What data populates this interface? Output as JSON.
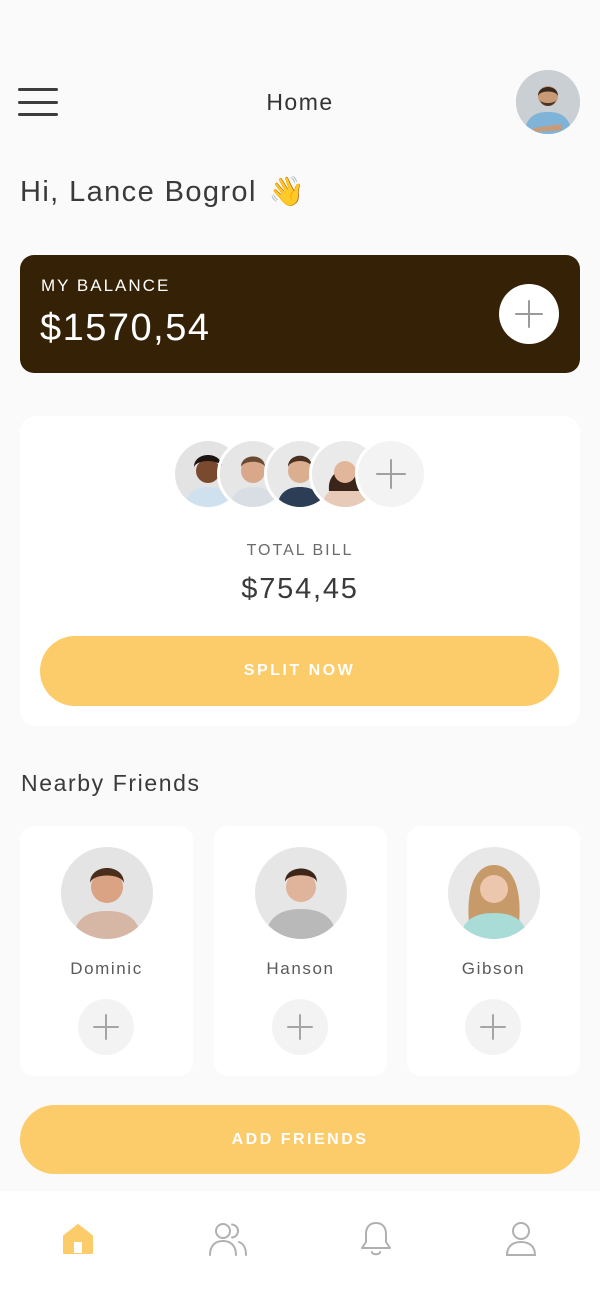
{
  "header": {
    "title": "Home",
    "menu_icon": "hamburger-menu-icon",
    "avatar_icon": "user-avatar"
  },
  "greeting": {
    "text": "Hi, Lance Bogrol",
    "emoji": "👋"
  },
  "balance": {
    "label": "MY BALANCE",
    "value": "$1570,54",
    "add_icon": "plus-icon"
  },
  "bill": {
    "participants_count_shown": 4,
    "label": "TOTAL BILL",
    "value": "$754,45",
    "button_label": "SPLIT NOW"
  },
  "nearby": {
    "title": "Nearby Friends",
    "friends": [
      {
        "name": "Dominic"
      },
      {
        "name": "Hanson"
      },
      {
        "name": "Gibson"
      }
    ]
  },
  "add_friends_label": "ADD FRIENDS",
  "nav": {
    "items": [
      "home-icon",
      "friends-icon",
      "bell-icon",
      "profile-icon"
    ],
    "active": "home-icon"
  },
  "colors": {
    "accent": "#fdcc6a",
    "balance_card": "#352206",
    "background": "#fafafa",
    "text": "#3f3f3f"
  }
}
